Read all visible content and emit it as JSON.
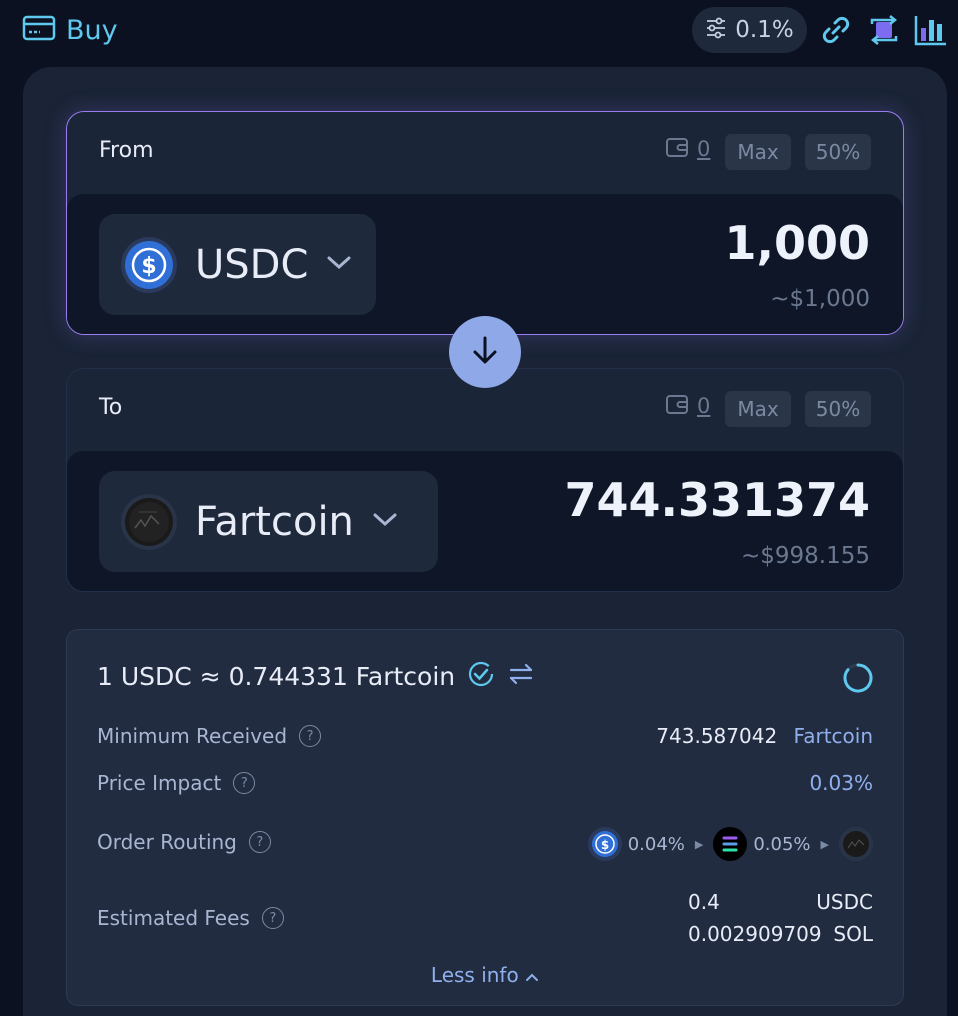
{
  "header": {
    "buy_label": "Buy",
    "slippage": "0.1%",
    "icons": [
      "card-icon",
      "sliders-icon",
      "link-icon",
      "swap-mode-icon",
      "chart-icon"
    ]
  },
  "from": {
    "label": "From",
    "balance": "0",
    "max_label": "Max",
    "half_label": "50%",
    "token": "USDC",
    "amount": "1,000",
    "usd": "~$1,000"
  },
  "to": {
    "label": "To",
    "balance": "0",
    "max_label": "Max",
    "half_label": "50%",
    "token": "Fartcoin",
    "amount": "744.331374",
    "usd": "~$998.155"
  },
  "info": {
    "rate": "1 USDC ≈ 0.744331 Fartcoin",
    "min_received_label": "Minimum Received",
    "min_received_value": "743.587042",
    "min_received_token": "Fartcoin",
    "price_impact_label": "Price Impact",
    "price_impact_value": "0.03%",
    "order_routing_label": "Order Routing",
    "route_pct_1": "0.04%",
    "route_pct_2": "0.05%",
    "fees_label": "Estimated Fees",
    "fee_1_amount": "0.4",
    "fee_1_unit": "USDC",
    "fee_2_amount": "0.002909709",
    "fee_2_unit": "SOL",
    "less_info": "Less info"
  },
  "colors": {
    "accent": "#5fc8ee",
    "highlight": "#8fb0ec",
    "from_border": "#9b7cf0",
    "switch_button": "#8fa8e8"
  }
}
